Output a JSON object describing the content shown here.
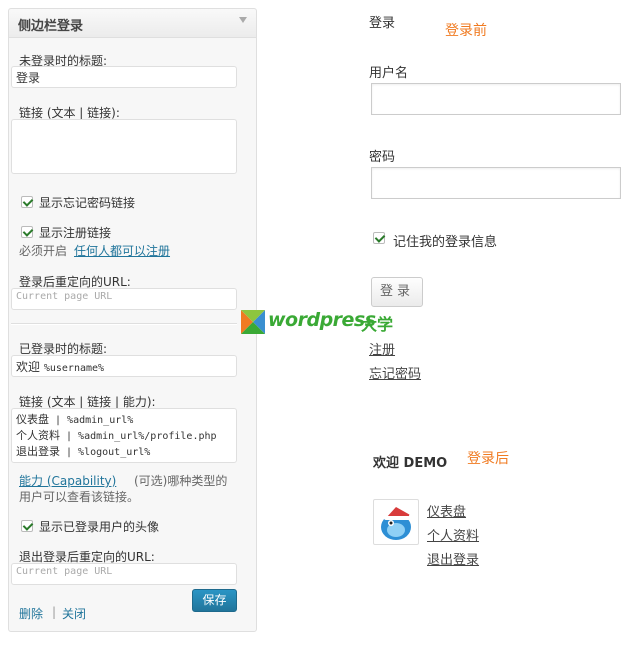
{
  "widget": {
    "title": "侧边栏登录",
    "logged_out_title_label": "未登录时的标题:",
    "logged_out_title_value": "登录",
    "links_label": "链接 (文本 | 链接):",
    "show_lost_password": "显示忘记密码链接",
    "show_register": "显示注册链接",
    "must_enable_prefix": "必须开启",
    "anyone_can_register": "任何人都可以注册",
    "redirect_label": "登录后重定向的URL:",
    "redirect_placeholder": "Current page URL",
    "logged_in_title_label": "已登录时的标题:",
    "logged_in_title_value_prefix": "欢迎",
    "logged_in_title_value_code": "%username%",
    "links_capability_label": "链接 (文本 | 链接 | 能力):",
    "links_lines": [
      {
        "text": "仪表盘",
        "code": " | %admin_url%"
      },
      {
        "text": "个人资料",
        "code": " | %admin_url%/profile.php"
      },
      {
        "text": "退出登录",
        "code": " | %logout_url%"
      }
    ],
    "capability_link": "能力 (Capability)",
    "capability_note_1": "(可选)哪种类型的",
    "capability_note_2": "用户可以查看该链接。",
    "show_avatar": "显示已登录用户的头像",
    "logout_redirect_label": "退出登录后重定向的URL:",
    "logout_redirect_placeholder": "Current page URL",
    "delete": "删除",
    "separator": "|",
    "close": "关闭",
    "save": "保存"
  },
  "before": {
    "heading": "登录",
    "tag": "登录前",
    "username_label": "用户名",
    "password_label": "密码",
    "remember_me": "记住我的登录信息",
    "login_button": "登录",
    "register_link": "注册",
    "lost_password_link": "忘记密码"
  },
  "watermark": {
    "text": "wordpress",
    "suffix": "大学"
  },
  "after": {
    "welcome": "欢迎 DEMO",
    "tag": "登录后",
    "links": [
      "仪表盘",
      "个人资料",
      "退出登录"
    ]
  },
  "colors": {
    "accent_blue": "#21759b",
    "orange": "#f07b22",
    "watermark_green": "#3aa935"
  }
}
